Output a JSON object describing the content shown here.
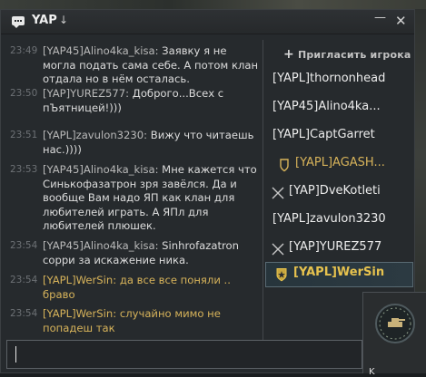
{
  "window": {
    "title": "YAP",
    "title_arrow": "↓",
    "minimize": "—",
    "close": "✕"
  },
  "messages": [
    {
      "time": "23:49",
      "sender": "[YAP45]Alino4ka_kisa:",
      "text": " Заявку я не могла подать сама себе. А потом клан отдала но в нём осталась.",
      "style": "normal"
    },
    {
      "time": "23:50",
      "sender": "[YAP]YUREZ577:",
      "text": " Доброго...Всех с пЪятницей!)))",
      "style": "normal"
    },
    {
      "time": "23:51",
      "sender": "[YAPL]zavulon3230:",
      "text": " Вижу что читаешь нас.))))",
      "style": "normal"
    },
    {
      "time": "23:53",
      "sender": "[YAP45]Alino4ka_kisa:",
      "text": " Мне кажется что Синькофазатрон зря завёлся. Да и вообще Вам надо ЯП как клан для любителей играть. А ЯПл для любителей плюшек.",
      "style": "normal"
    },
    {
      "time": "23:54",
      "sender": "[YAP45]Alino4ka_kisa:",
      "text": " Sinhrofazatron сорри за искажение ника.",
      "style": "normal"
    },
    {
      "time": "23:54",
      "sender": "[YAPL]WerSin:",
      "text": " да все все поняли .. браво",
      "style": "gold"
    },
    {
      "time": "23:54",
      "sender": "[YAPL]WerSin:",
      "text": " случайно мимо не попадеш так",
      "style": "gold"
    }
  ],
  "invite_label": "Пригласить игрока",
  "members": [
    {
      "name": "[YAPL]thornonhead",
      "icon": "none",
      "style": "normal"
    },
    {
      "name": "[YAP45]Alino4ka...",
      "icon": "none",
      "style": "normal"
    },
    {
      "name": "[YAPL]CaptGarret",
      "icon": "none",
      "style": "normal"
    },
    {
      "name": "[YAPL]AGASH...",
      "icon": "shield-icon",
      "style": "gold"
    },
    {
      "name": "[YAP]DveKotleti",
      "icon": "crossed-swords-icon",
      "style": "normal"
    },
    {
      "name": "[YAPL]zavulon3230",
      "icon": "none",
      "style": "normal"
    },
    {
      "name": "[YAP]YUREZ577",
      "icon": "crossed-swords-icon",
      "style": "normal"
    },
    {
      "name": "[YAPL]WerSin",
      "icon": "star-shield-icon",
      "style": "selected"
    }
  ],
  "input": {
    "value": "",
    "placeholder": ""
  },
  "badge_panel": {
    "label": "K"
  },
  "colors": {
    "accent_gold": "#d7b35a",
    "selected_gold": "#e6c24e",
    "text": "#dcdcdc",
    "timestamp": "#6d7175"
  }
}
